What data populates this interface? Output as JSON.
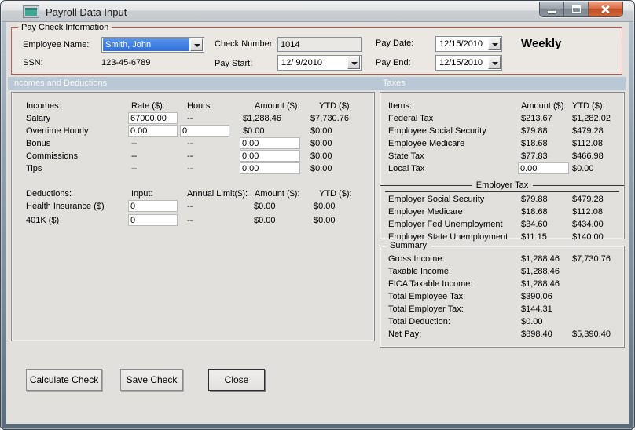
{
  "window": {
    "title": "Payroll Data Input"
  },
  "icons": {
    "app_icon": "form-icon",
    "minimize": "minimize-bar",
    "maximize": "maximize-square",
    "close": "close-x",
    "dropdown": "down-arrow-triangle"
  },
  "paycheck": {
    "group_title": "Pay Check Information",
    "employee_name_label": "Employee Name:",
    "employee_name_value": "Smith, John",
    "ssn_label": "SSN:",
    "ssn_value": "123-45-6789",
    "check_number_label": "Check Number:",
    "check_number_value": "1014",
    "pay_start_label": "Pay Start:",
    "pay_start_value": "12/ 9/2010",
    "pay_date_label": "Pay Date:",
    "pay_date_value": "12/15/2010",
    "pay_end_label": "Pay End:",
    "pay_end_value": "12/15/2010",
    "frequency": "Weekly"
  },
  "section_headers": {
    "left": "Incomes and Deductions",
    "right": "Taxes"
  },
  "incomes": {
    "title": "Incomes:",
    "col_rate": "Rate ($):",
    "col_hours": "Hours:",
    "col_amount": "Amount ($):",
    "col_ytd": "YTD ($):",
    "rows": [
      {
        "label": "Salary",
        "rate": "67000.00",
        "hours": "--",
        "amount": "$1,288.46",
        "ytd": "$7,730.76"
      },
      {
        "label": "Overtime Hourly",
        "rate": "0.00",
        "hours": "0",
        "amount": "$0.00",
        "ytd": "$0.00"
      },
      {
        "label": "Bonus",
        "rate": "--",
        "hours": "--",
        "amount": "0.00",
        "ytd": "$0.00"
      },
      {
        "label": "Commissions",
        "rate": "--",
        "hours": "--",
        "amount": "0.00",
        "ytd": "$0.00"
      },
      {
        "label": "Tips",
        "rate": "--",
        "hours": "--",
        "amount": "0.00",
        "ytd": "$0.00"
      }
    ]
  },
  "deductions": {
    "title": "Deductions:",
    "col_input": "Input:",
    "col_limit": "Annual Limit($):",
    "col_amount": "Amount ($):",
    "col_ytd": "YTD ($):",
    "rows": [
      {
        "label": "Health Insurance ($)",
        "input": "0",
        "limit": "--",
        "amount": "$0.00",
        "ytd": "$0.00"
      },
      {
        "label": "401K ($)",
        "input": "0",
        "limit": "--",
        "amount": "$0.00",
        "ytd": "$0.00"
      }
    ]
  },
  "taxes": {
    "col_items": "Items:",
    "col_amount": "Amount ($):",
    "col_ytd": "YTD ($):",
    "employee_rows": [
      {
        "label": "Federal Tax",
        "amount": "$213.67",
        "ytd": "$1,282.02"
      },
      {
        "label": "Employee Social Security",
        "amount": "$79.88",
        "ytd": "$479.28"
      },
      {
        "label": "Employee Medicare",
        "amount": "$18.68",
        "ytd": "$112.08"
      },
      {
        "label": "State Tax",
        "amount": "$77.83",
        "ytd": "$466.98"
      },
      {
        "label": "Local Tax",
        "amount": "0.00",
        "ytd": "$0.00"
      }
    ],
    "employer_title": "Employer Tax",
    "employer_rows": [
      {
        "label": "Employer Social Security",
        "amount": "$79.88",
        "ytd": "$479.28"
      },
      {
        "label": "Employer Medicare",
        "amount": "$18.68",
        "ytd": "$112.08"
      },
      {
        "label": "Employer Fed Unemployment",
        "amount": "$34.60",
        "ytd": "$434.00"
      },
      {
        "label": "Employer State Unemployment",
        "amount": "$11.15",
        "ytd": "$140.00"
      }
    ]
  },
  "summary": {
    "title": "Summary",
    "rows": [
      {
        "label": "Gross Income:",
        "amount": "$1,288.46",
        "ytd": "$7,730.76"
      },
      {
        "label": "Taxable Income:",
        "amount": "$1,288.46",
        "ytd": ""
      },
      {
        "label": "FICA Taxable Income:",
        "amount": "$1,288.46",
        "ytd": ""
      },
      {
        "label": "Total Employee Tax:",
        "amount": "$390.06",
        "ytd": ""
      },
      {
        "label": "Total Employer Tax:",
        "amount": "$144.31",
        "ytd": ""
      },
      {
        "label": "Total Deduction:",
        "amount": "$0.00",
        "ytd": ""
      },
      {
        "label": "Net Pay:",
        "amount": "$898.40",
        "ytd": "$5,390.40"
      }
    ]
  },
  "buttons": {
    "calculate": "Calculate Check",
    "save": "Save Check",
    "close": "Close"
  },
  "colors": {
    "section_bar": "#bac8d5",
    "paycheck_border": "#bf574c",
    "selection_blue": "#3b7bdd",
    "close_button_red": "#c24e26"
  }
}
